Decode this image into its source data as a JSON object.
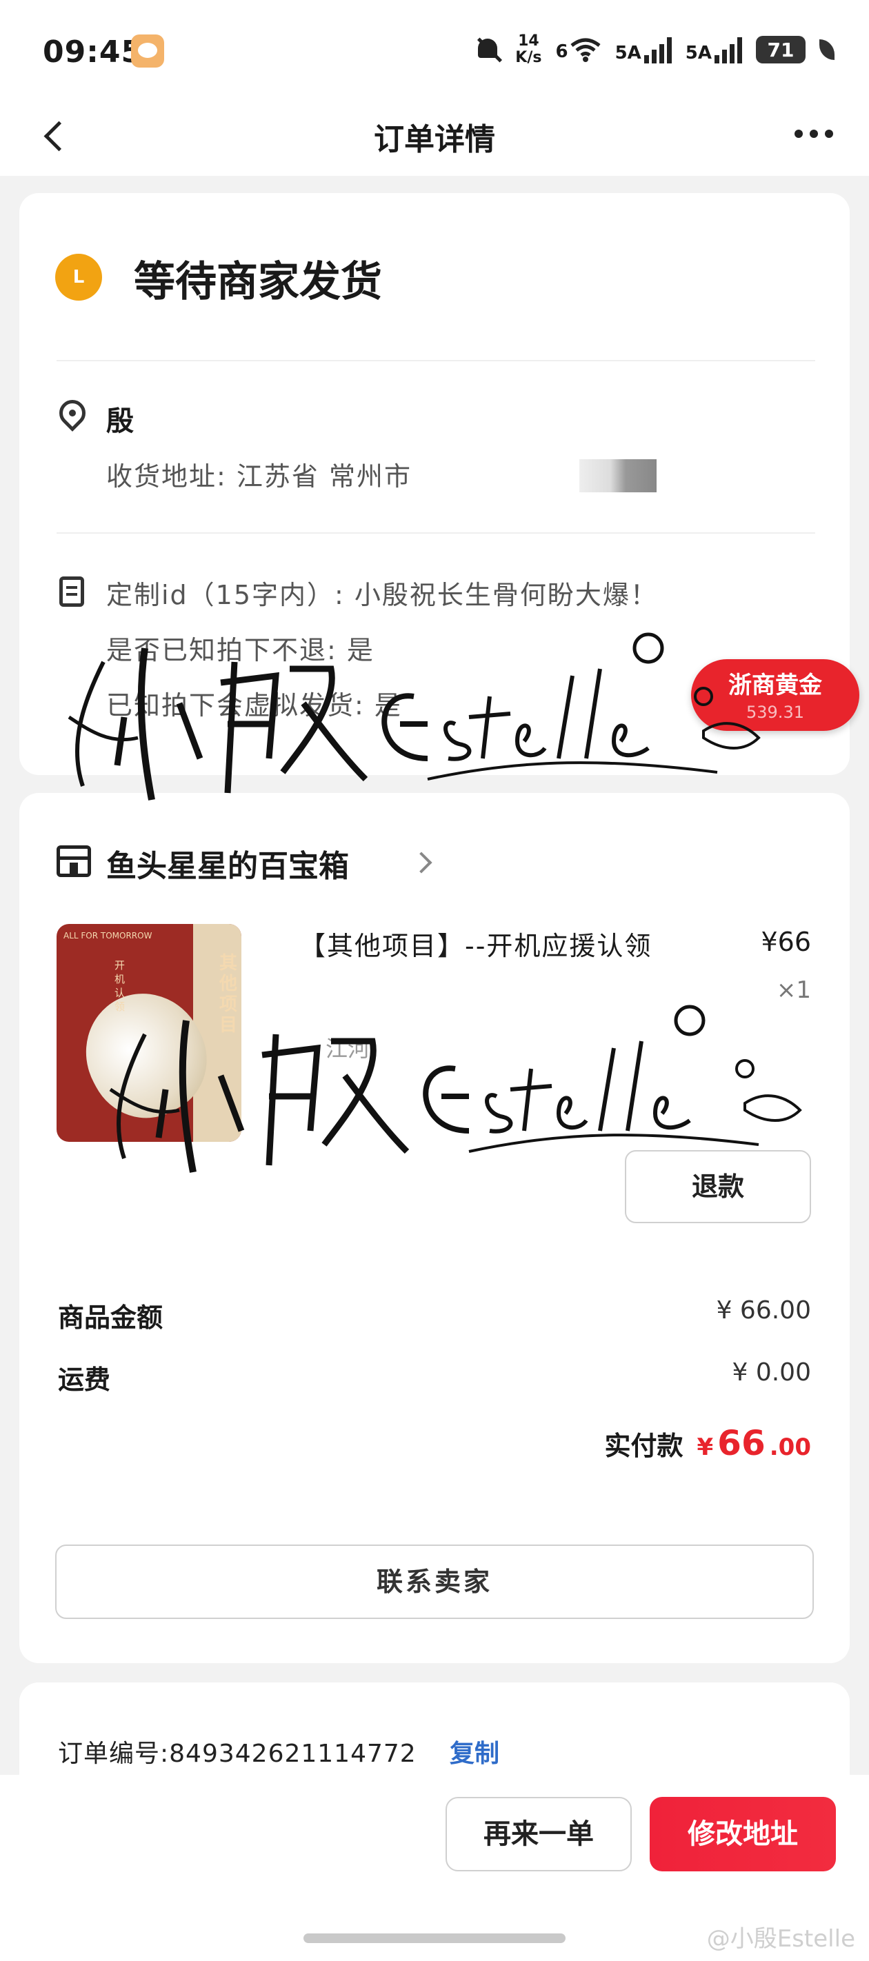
{
  "status_bar": {
    "time": "09:45",
    "net_speed_value": "14",
    "net_speed_unit": "K/s",
    "wifi_label": "6",
    "signal1_label": "5A",
    "signal2_label": "5A",
    "battery": "71"
  },
  "nav": {
    "title": "订单详情",
    "back_icon": "chevron-left-icon",
    "more_icon": "more-dots-icon"
  },
  "order_status": {
    "badge": "L",
    "title": "等待商家发货"
  },
  "shipping": {
    "recipient": "殷",
    "address": "收货地址: 江苏省 常州市"
  },
  "customization": {
    "lines": [
      "定制id（15字内）: 小殷祝长生骨何盼大爆！",
      "是否已知拍下不退: 是",
      "已知拍下会虚拟发货: 是"
    ]
  },
  "stamp": {
    "label": "浙商黄金",
    "value": "539.31"
  },
  "shop": {
    "name": "鱼头星星的百宝箱",
    "icon": "store-icon"
  },
  "product": {
    "title": "【其他项目】--开机应援认领",
    "price": "¥66",
    "quantity": "×1",
    "spec": "江河",
    "refund_label": "退款",
    "thumb_caption": "ALL FOR TOMORROW",
    "thumb_text": "其他项目",
    "thumb_small": "开机认领"
  },
  "fees": {
    "goods_label": "商品金额",
    "goods_value": "¥ 66.00",
    "shipping_label": "运费",
    "shipping_value": "¥ 0.00",
    "paid_label": "实付款",
    "paid_currency": "¥",
    "paid_integer": "66",
    "paid_decimal": ".00",
    "contact_label": "联系卖家"
  },
  "order_info": {
    "number_label": "订单编号:",
    "number": "849342621114772",
    "copy_label": "复制"
  },
  "bottom_actions": {
    "reorder_label": "再来一单",
    "change_address_label": "修改地址"
  },
  "watermark": {
    "text": "小殷Estelle",
    "weibo": "@小殷Estelle"
  },
  "colors": {
    "accent_red": "#e8242c",
    "status_orange": "#f2a312",
    "link_blue": "#2f6cc9",
    "background": "#f2f2f2"
  }
}
